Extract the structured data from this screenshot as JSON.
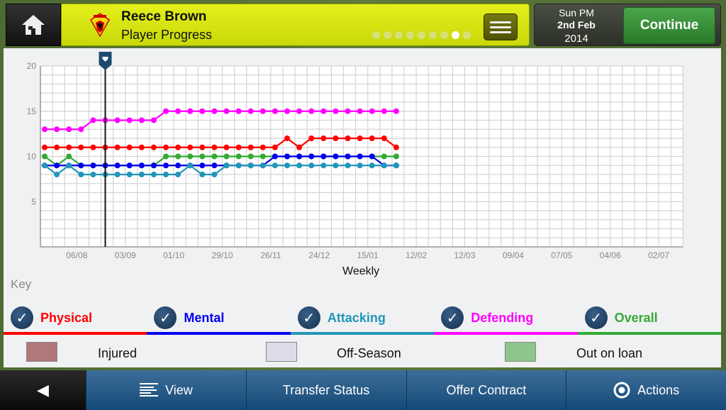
{
  "header": {
    "player_name": "Reece Brown",
    "page_title": "Player Progress",
    "pager": {
      "total": 9,
      "active_index": 7
    }
  },
  "date": {
    "line1": "Sun PM",
    "line2": "2nd Feb",
    "line3": "2014"
  },
  "continue_label": "Continue",
  "chart_data": {
    "type": "line",
    "xlabel": "Weekly",
    "ylabel": "",
    "ylim": [
      0,
      20
    ],
    "yticks": [
      5,
      10,
      15,
      20
    ],
    "xtick_labels": [
      "06/08",
      "03/09",
      "01/10",
      "29/10",
      "26/11",
      "24/12",
      "15/01",
      "12/02",
      "12/03",
      "09/04",
      "07/05",
      "04/06",
      "02/07"
    ],
    "total_weeks": 53,
    "grid": true,
    "current_week_marker": 5,
    "series": [
      {
        "name": "Physical",
        "color": "#ff0000",
        "values": [
          11,
          11,
          11,
          11,
          11,
          11,
          11,
          11,
          11,
          11,
          11,
          11,
          11,
          11,
          11,
          11,
          11,
          11,
          11,
          11,
          12,
          11,
          12,
          12,
          12,
          12,
          12,
          12,
          12,
          11
        ]
      },
      {
        "name": "Mental",
        "color": "#0000ee",
        "values": [
          9,
          9,
          9,
          9,
          9,
          9,
          9,
          9,
          9,
          9,
          9,
          9,
          9,
          9,
          9,
          9,
          9,
          9,
          9,
          10,
          10,
          10,
          10,
          10,
          10,
          10,
          10,
          10,
          9,
          9
        ]
      },
      {
        "name": "Attacking",
        "color": "#2196b8",
        "values": [
          9,
          8,
          9,
          8,
          8,
          8,
          8,
          8,
          8,
          8,
          8,
          8,
          9,
          8,
          8,
          9,
          9,
          9,
          9,
          9,
          9,
          9,
          9,
          9,
          9,
          9,
          9,
          9,
          9,
          9
        ]
      },
      {
        "name": "Defending",
        "color": "#ff00ff",
        "values": [
          13,
          13,
          13,
          13,
          14,
          14,
          14,
          14,
          14,
          14,
          15,
          15,
          15,
          15,
          15,
          15,
          15,
          15,
          15,
          15,
          15,
          15,
          15,
          15,
          15,
          15,
          15,
          15,
          15,
          15
        ]
      },
      {
        "name": "Overall",
        "color": "#33aa33",
        "values": [
          10,
          9,
          10,
          9,
          9,
          9,
          9,
          9,
          9,
          9,
          10,
          10,
          10,
          10,
          10,
          10,
          10,
          10,
          10,
          10,
          10,
          10,
          10,
          10,
          10,
          10,
          10,
          10,
          10,
          10
        ]
      }
    ]
  },
  "key": {
    "title": "Key",
    "items": [
      {
        "label": "Physical",
        "color": "#ff0000",
        "checked": true
      },
      {
        "label": "Mental",
        "color": "#0000ee",
        "checked": true
      },
      {
        "label": "Attacking",
        "color": "#2196b8",
        "checked": true
      },
      {
        "label": "Defending",
        "color": "#ff00ff",
        "checked": true
      },
      {
        "label": "Overall",
        "color": "#33aa33",
        "checked": true
      }
    ],
    "status": [
      {
        "label": "Injured",
        "color": "#b07878"
      },
      {
        "label": "Off-Season",
        "color": "#dcdcea"
      },
      {
        "label": "Out on loan",
        "color": "#8cc68c"
      }
    ]
  },
  "bottom": {
    "view": "View",
    "transfer": "Transfer Status",
    "offer": "Offer Contract",
    "actions": "Actions"
  }
}
